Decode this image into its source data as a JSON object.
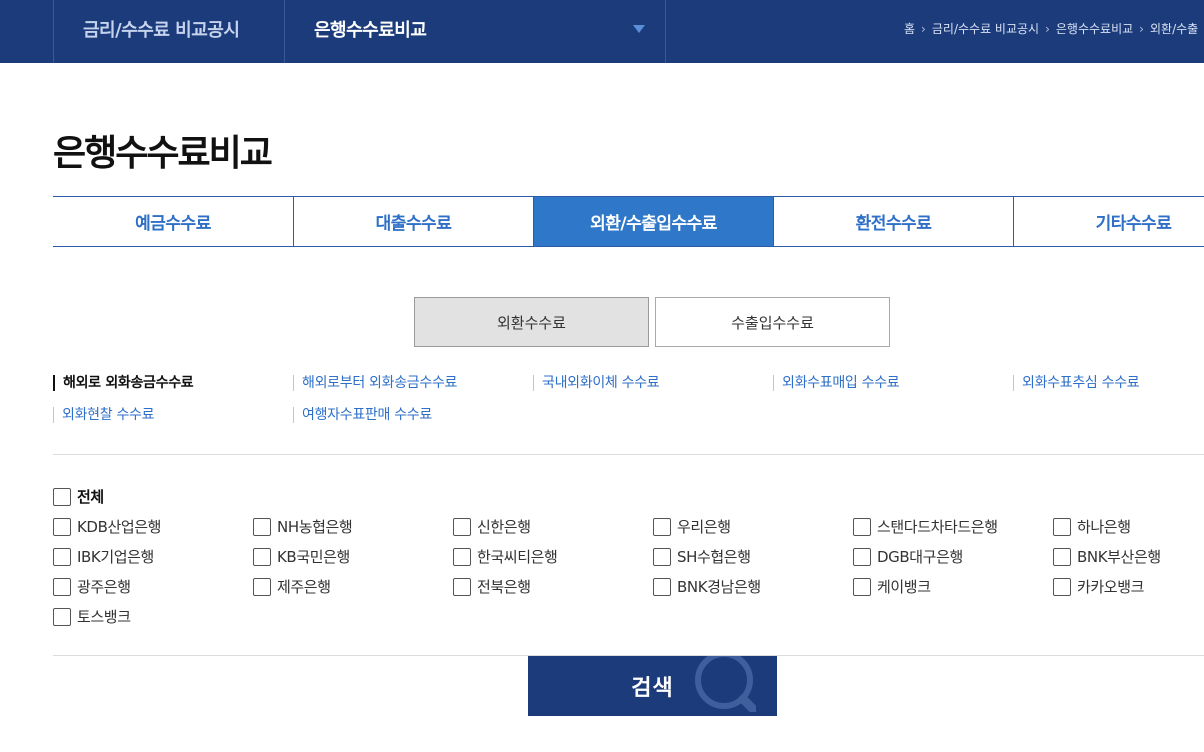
{
  "topbar": {
    "menu1": "금리/수수료 비교공시",
    "menu2": "은행수수료비교",
    "breadcrumb": [
      "홈",
      "금리/수수료 비교공시",
      "은행수수료비교",
      "외환/수출"
    ]
  },
  "page_title": "은행수수료비교",
  "tabs": [
    {
      "label": "예금수수료"
    },
    {
      "label": "대출수수료"
    },
    {
      "label": "외환/수출입수수료"
    },
    {
      "label": "환전수수료"
    },
    {
      "label": "기타수수료"
    }
  ],
  "subtabs": [
    {
      "label": "외환수수료"
    },
    {
      "label": "수출입수수료"
    }
  ],
  "fee_links": [
    {
      "label": "해외로 외화송금수수료"
    },
    {
      "label": "해외로부터 외화송금수수료"
    },
    {
      "label": "국내외화이체 수수료"
    },
    {
      "label": "외화수표매입 수수료"
    },
    {
      "label": "외화수표추심 수수료"
    },
    {
      "label": "외화현찰 수수료"
    },
    {
      "label": "여행자수표판매 수수료"
    }
  ],
  "banks": {
    "all_label": "전체",
    "items": [
      {
        "label": "KDB산업은행"
      },
      {
        "label": "NH농협은행"
      },
      {
        "label": "신한은행"
      },
      {
        "label": "우리은행"
      },
      {
        "label": "스탠다드차타드은행"
      },
      {
        "label": "하나은행"
      },
      {
        "label": "IBK기업은행"
      },
      {
        "label": "KB국민은행"
      },
      {
        "label": "한국씨티은행"
      },
      {
        "label": "SH수협은행"
      },
      {
        "label": "DGB대구은행"
      },
      {
        "label": "BNK부산은행"
      },
      {
        "label": "광주은행"
      },
      {
        "label": "제주은행"
      },
      {
        "label": "전북은행"
      },
      {
        "label": "BNK경남은행"
      },
      {
        "label": "케이뱅크"
      },
      {
        "label": "카카오뱅크"
      },
      {
        "label": "토스뱅크"
      }
    ]
  },
  "search_label": "검색",
  "colors": {
    "navy": "#1b3b7a",
    "accent_blue": "#2f77c9",
    "link_blue": "#2e6fc8"
  }
}
